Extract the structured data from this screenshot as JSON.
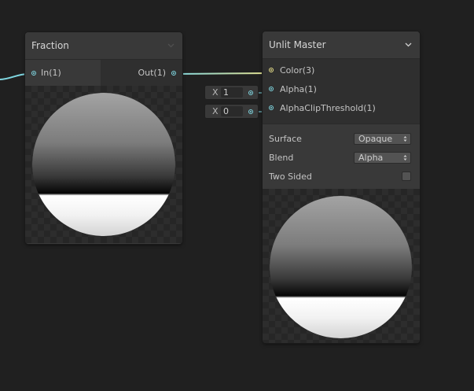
{
  "fraction_node": {
    "title": "Fraction",
    "input_port": "In(1)",
    "output_port": "Out(1)"
  },
  "unlit_master_node": {
    "title": "Unlit Master",
    "ports": [
      "Color(3)",
      "Alpha(1)",
      "AlphaClipThreshold(1)"
    ],
    "settings": {
      "surface_label": "Surface",
      "surface_value": "Opaque",
      "blend_label": "Blend",
      "blend_value": "Alpha",
      "two_sided_label": "Two Sided",
      "two_sided_checked": false
    }
  },
  "inline_inputs": [
    {
      "axis": "X",
      "value": "1"
    },
    {
      "axis": "X",
      "value": "0"
    }
  ],
  "colors": {
    "canvas_bg": "#202020",
    "node_bg": "#393939",
    "port_vector1": "#7fd6e0",
    "port_vector3": "#e8e08a"
  },
  "icons": {
    "collapse": "chevron-down-icon",
    "dropdown": "updown-arrows-icon"
  }
}
